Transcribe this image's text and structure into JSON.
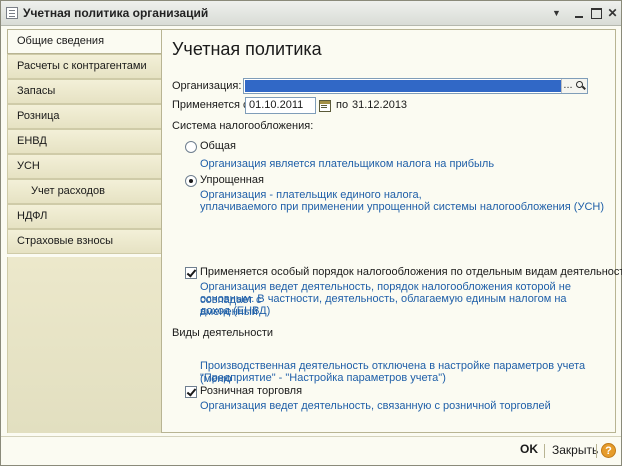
{
  "window": {
    "title": "Учетная политика организаций",
    "menu_glyph": "▼"
  },
  "nav": {
    "items": [
      {
        "label": "Общие сведения"
      },
      {
        "label": "Расчеты с контрагентами"
      },
      {
        "label": "Запасы"
      },
      {
        "label": "Розница"
      },
      {
        "label": "ЕНВД"
      },
      {
        "label": "УСН"
      },
      {
        "label": "Учет расходов"
      },
      {
        "label": "НДФЛ"
      },
      {
        "label": "Страховые взносы"
      }
    ]
  },
  "main": {
    "title": "Учетная политика",
    "org_label": "Организация:",
    "org_ellipsis": "...",
    "applies_label": "Применяется с:",
    "date_from": "01.10.2011",
    "to_label": "по",
    "date_to": "31.12.2013",
    "tax_system_label": "Система налогообложения:",
    "general_label": "Общая",
    "general_desc": "Организация является плательщиком налога на прибыль",
    "simplified_label": "Упрощенная",
    "simplified_desc_1": "Организация - плательщик единого налога,",
    "simplified_desc_2": "уплачиваемого при применении упрощенной системы налогообложения (УСН)",
    "special_label": "Применяется особый порядок налогообложения по отдельным видам деятельности",
    "special_desc_1": "Организация ведет деятельность, порядок налогообложения которой не совпадает с",
    "special_desc_2": "основным. В частности, деятельность, облагаемую единым налогом на вмененный",
    "special_desc_3": "доход (ЕНВД)",
    "activities_label": "Виды деятельности",
    "production_desc_1": "Производственная деятельность отключена в настройке параметров учета (меню",
    "production_desc_2": "\"Предприятие\" - \"Настройка параметров учета\")",
    "retail_label": "Розничная торговля",
    "retail_desc": "Организация ведет деятельность, связанную с розничной торговлей"
  },
  "footer": {
    "ok_label": "OK",
    "close_label": "Закрыть",
    "help_label": "?"
  },
  "colors": {
    "link_blue": "#1f5fa8",
    "selection_blue": "#3168c6",
    "nav_bg": "#e6e2c3"
  }
}
